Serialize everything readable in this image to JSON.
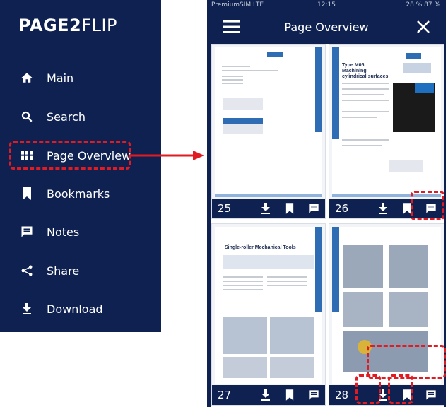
{
  "menu": {
    "logo_bold": "PAGE2",
    "logo_thin": "FLIP",
    "items": [
      {
        "label": "Main",
        "icon": "home-icon"
      },
      {
        "label": "Search",
        "icon": "search-icon"
      },
      {
        "label": "Page Overview",
        "icon": "grid-icon"
      },
      {
        "label": "Bookmarks",
        "icon": "bookmark-icon"
      },
      {
        "label": "Notes",
        "icon": "note-icon"
      },
      {
        "label": "Share",
        "icon": "share-icon"
      },
      {
        "label": "Download",
        "icon": "download-icon"
      }
    ]
  },
  "status": {
    "carrier": "PremiumSIM  LTE",
    "time": "12:15",
    "battery": "28 % 87 %"
  },
  "topbar": {
    "title": "Page Overview"
  },
  "pages": [
    {
      "number": "25",
      "page_title": ""
    },
    {
      "number": "26",
      "page_title": "Type M05: Machining cylindrical surfaces"
    },
    {
      "number": "27",
      "page_title": "Single-roller Mechanical Tools"
    },
    {
      "number": "28",
      "page_title": ""
    }
  ],
  "colors": {
    "navy": "#0e2150",
    "accent_blue": "#2e6db4",
    "highlight_red": "#e11b22"
  }
}
